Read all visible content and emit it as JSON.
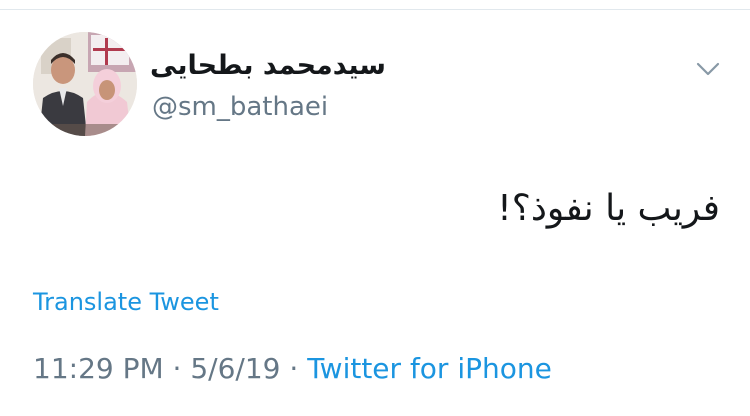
{
  "tweet": {
    "author": {
      "display_name": "سیدمحمد بطحایی",
      "handle": "@sm_bathaei"
    },
    "text": "فریب یا نفوذ؟!",
    "translate_label": "Translate Tweet",
    "time": "11:29 PM",
    "date": "5/6/19",
    "separator": "·",
    "source": "Twitter for iPhone"
  },
  "icons": {
    "menu": "chevron-down-icon",
    "avatar": "profile-photo"
  },
  "colors": {
    "link": "#1b95e0",
    "muted": "#657786",
    "text": "#14171a"
  }
}
